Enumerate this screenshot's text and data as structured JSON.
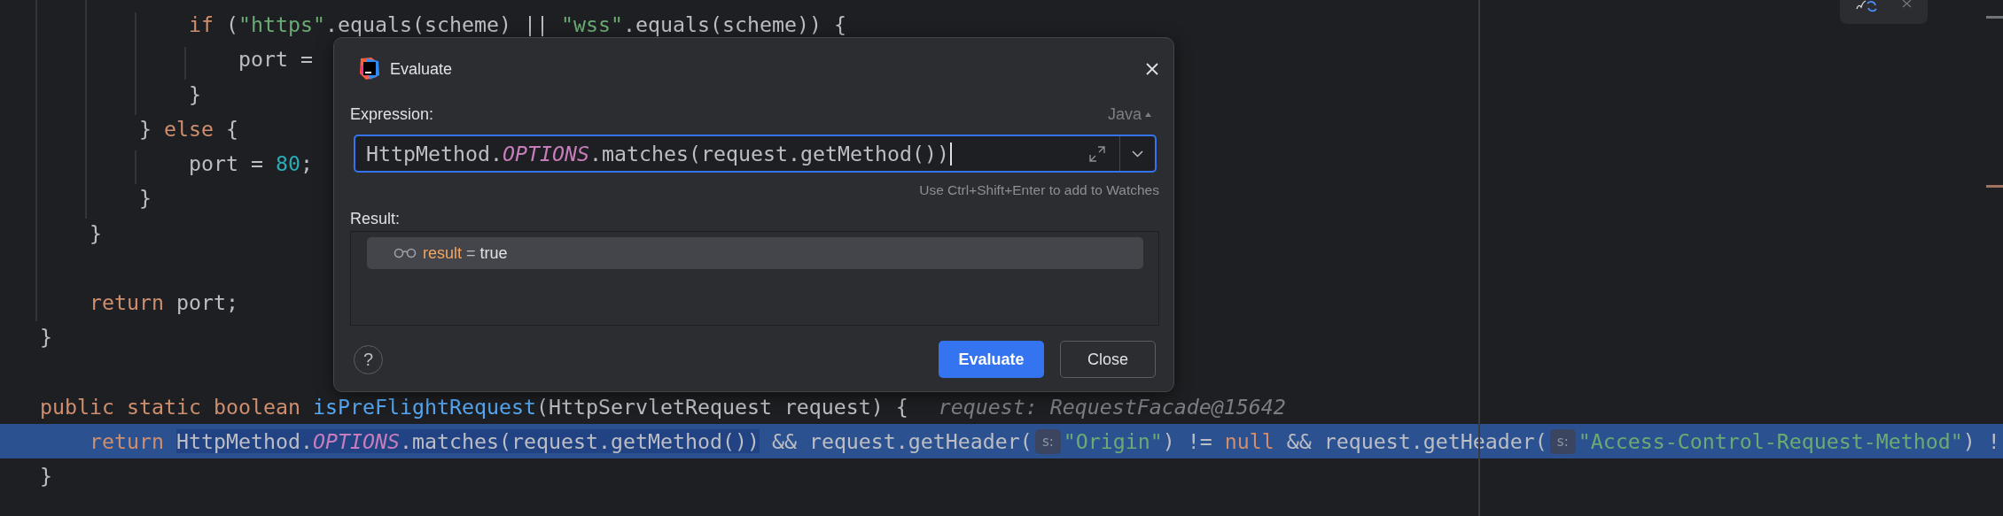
{
  "editor": {
    "lines": [
      {
        "kind": "code",
        "current": false,
        "runs": [
          {
            "kind": "code",
            "tokens": [
              {
                "text": "            if",
                "kind": "keyword"
              },
              {
                "text": " (",
                "kind": "plain"
              },
              {
                "text": "\"https\"",
                "kind": "string"
              },
              {
                "text": ".equals(scheme) || ",
                "kind": "plain"
              },
              {
                "text": "\"wss\"",
                "kind": "string"
              },
              {
                "text": ".equals(scheme)) {",
                "kind": "plain"
              }
            ]
          }
        ]
      },
      {
        "kind": "code",
        "current": false,
        "runs": [
          {
            "kind": "code",
            "tokens": [
              {
                "text": "                port =",
                "kind": "plain"
              }
            ]
          }
        ]
      },
      {
        "kind": "code",
        "current": false,
        "runs": [
          {
            "kind": "code",
            "tokens": [
              {
                "text": "            }",
                "kind": "plain"
              }
            ]
          }
        ]
      },
      {
        "kind": "code",
        "current": false,
        "runs": [
          {
            "kind": "code",
            "tokens": [
              {
                "text": "        } ",
                "kind": "plain"
              },
              {
                "text": "else",
                "kind": "keyword"
              },
              {
                "text": " {",
                "kind": "plain"
              }
            ]
          }
        ]
      },
      {
        "kind": "code",
        "current": false,
        "runs": [
          {
            "kind": "code",
            "tokens": [
              {
                "text": "            port = ",
                "kind": "plain"
              },
              {
                "text": "80",
                "kind": "number"
              },
              {
                "text": ";",
                "kind": "plain"
              }
            ]
          }
        ]
      },
      {
        "kind": "code",
        "current": false,
        "runs": [
          {
            "kind": "code",
            "tokens": [
              {
                "text": "        }",
                "kind": "plain"
              }
            ]
          }
        ]
      },
      {
        "kind": "code",
        "current": false,
        "runs": [
          {
            "kind": "code",
            "tokens": [
              {
                "text": "    }",
                "kind": "plain"
              }
            ]
          }
        ]
      },
      {
        "kind": "blank"
      },
      {
        "kind": "code",
        "current": false,
        "runs": [
          {
            "kind": "code",
            "tokens": [
              {
                "text": "    return",
                "kind": "keyword"
              },
              {
                "text": " port;",
                "kind": "plain"
              }
            ]
          }
        ]
      },
      {
        "kind": "code",
        "current": false,
        "runs": [
          {
            "kind": "code",
            "tokens": [
              {
                "text": "}",
                "kind": "plain"
              }
            ]
          }
        ]
      },
      {
        "kind": "blank"
      },
      {
        "kind": "code",
        "current": false,
        "runs": [
          {
            "kind": "code",
            "tokens": [
              {
                "text": "public static boolean ",
                "kind": "keyword"
              },
              {
                "text": "isPreFlightRequest",
                "kind": "method"
              },
              {
                "text": "(HttpServletRequest request) {",
                "kind": "plain"
              }
            ]
          },
          {
            "kind": "value_hint",
            "text": "request: RequestFacade@15642"
          }
        ]
      },
      {
        "kind": "code",
        "current": true,
        "runs": [
          {
            "kind": "code",
            "selected": false,
            "tokens": [
              {
                "text": "    return ",
                "kind": "keyword"
              }
            ]
          },
          {
            "kind": "code",
            "selected": true,
            "tokens": [
              {
                "text": "HttpMethod.",
                "kind": "plain"
              },
              {
                "text": "OPTIONS",
                "kind": "static"
              },
              {
                "text": ".matches(request.getMethod())",
                "kind": "plain"
              }
            ]
          },
          {
            "kind": "code",
            "selected": false,
            "tokens": [
              {
                "text": " && request.getHeader(",
                "kind": "plain"
              }
            ]
          },
          {
            "kind": "param_hint",
            "text": "s:"
          },
          {
            "kind": "code",
            "selected": false,
            "tokens": [
              {
                "text": "\"Origin\"",
                "kind": "string"
              },
              {
                "text": ") != ",
                "kind": "plain"
              },
              {
                "text": "null",
                "kind": "keyword"
              },
              {
                "text": " && request.getHeader(",
                "kind": "plain"
              }
            ]
          },
          {
            "kind": "param_hint",
            "text": "s:"
          },
          {
            "kind": "code",
            "selected": false,
            "tokens": [
              {
                "text": "\"Access-Control-Request-Method\"",
                "kind": "string"
              },
              {
                "text": ") !",
                "kind": "plain"
              }
            ]
          }
        ]
      },
      {
        "kind": "code",
        "current": false,
        "runs": [
          {
            "kind": "code",
            "tokens": [
              {
                "text": "}",
                "kind": "plain"
              }
            ]
          }
        ]
      }
    ]
  },
  "dialog": {
    "title": "Evaluate",
    "expression_label": "Expression:",
    "language": "Java",
    "expression": [
      {
        "text": "HttpMethod.",
        "kind": "plain"
      },
      {
        "text": "OPTIONS",
        "kind": "static"
      },
      {
        "text": ".matches(request.getMethod())",
        "kind": "plain"
      }
    ],
    "hint": "Use Ctrl+Shift+Enter to add to Watches",
    "result_label": "Result:",
    "results": [
      {
        "name": "result",
        "operator": "=",
        "value": "true",
        "selected": true
      }
    ],
    "help": "?",
    "buttons": [
      {
        "label": "Evaluate",
        "kind": "primary"
      },
      {
        "label": "Close",
        "kind": "secondary"
      }
    ]
  }
}
